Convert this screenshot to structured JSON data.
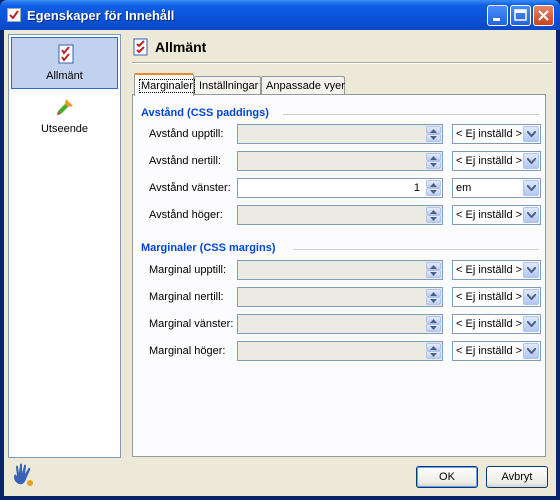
{
  "window": {
    "title": "Egenskaper för Innehåll"
  },
  "sidebar": {
    "items": [
      {
        "label": "Allmänt",
        "icon": "checklist-icon"
      },
      {
        "label": "Utseende",
        "icon": "paintbrush-icon"
      }
    ]
  },
  "header": {
    "title": "Allmänt"
  },
  "tabs": [
    "Marginaler",
    "Inställningar",
    "Anpassade vyer"
  ],
  "paddings": {
    "title": "Avstånd (CSS paddings)",
    "rows": [
      {
        "label": "Avstånd upptill:",
        "value": "",
        "unit": "< Ej inställd >"
      },
      {
        "label": "Avstånd nertill:",
        "value": "",
        "unit": "< Ej inställd >"
      },
      {
        "label": "Avstånd vänster:",
        "value": "1",
        "unit": "em"
      },
      {
        "label": "Avstånd höger:",
        "value": "",
        "unit": "< Ej inställd >"
      }
    ]
  },
  "margins": {
    "title": "Marginaler (CSS margins)",
    "rows": [
      {
        "label": "Marginal upptill:",
        "value": "",
        "unit": "< Ej inställd >"
      },
      {
        "label": "Marginal nertill:",
        "value": "",
        "unit": "< Ej inställd >"
      },
      {
        "label": "Marginal vänster:",
        "value": "",
        "unit": "< Ej inställd >"
      },
      {
        "label": "Marginal höger:",
        "value": "",
        "unit": "< Ej inställd >"
      }
    ]
  },
  "buttons": {
    "ok": "OK",
    "cancel": "Avbryt"
  }
}
